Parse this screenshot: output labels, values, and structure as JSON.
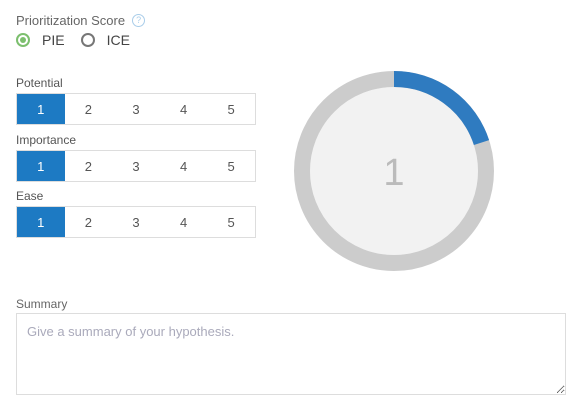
{
  "score": {
    "title": "Prioritization Score",
    "help_glyph": "?",
    "options": [
      {
        "label": "PIE",
        "checked": true
      },
      {
        "label": "ICE",
        "checked": false
      }
    ]
  },
  "ratings": [
    {
      "label": "Potential",
      "options": [
        "1",
        "2",
        "3",
        "4",
        "5"
      ],
      "selected": "1"
    },
    {
      "label": "Importance",
      "options": [
        "1",
        "2",
        "3",
        "4",
        "5"
      ],
      "selected": "1"
    },
    {
      "label": "Ease",
      "options": [
        "1",
        "2",
        "3",
        "4",
        "5"
      ],
      "selected": "1"
    }
  ],
  "donut": {
    "value": "1",
    "fraction": 0.2,
    "accent_color": "#2f7bc0",
    "track_color": "#cccccc"
  },
  "summary": {
    "label": "Summary",
    "placeholder": "Give a summary of your hypothesis.",
    "value": ""
  }
}
